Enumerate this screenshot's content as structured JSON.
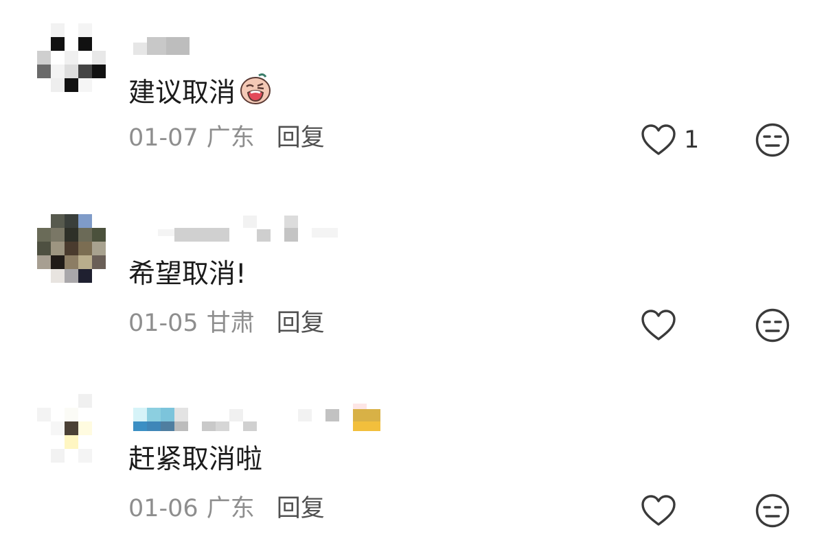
{
  "comments": [
    {
      "text": "建议取消",
      "date": "01-07",
      "region": "广东",
      "reply_label": "回复",
      "like_count": "1",
      "sticker": "crying-emoji-icon"
    },
    {
      "text": "希望取消!",
      "date": "01-05",
      "region": "甘肃",
      "reply_label": "回复",
      "like_count": ""
    },
    {
      "text": "赶紧取消啦",
      "date": "01-06",
      "region": "广东",
      "reply_label": "回复",
      "like_count": ""
    }
  ],
  "icons": {
    "like": "heart-icon",
    "dislike": "meh-face-icon"
  },
  "colors": {
    "text": "#1b1b1b",
    "meta": "#8e8e8e",
    "reply": "#505050",
    "icon": "#3a3a3a"
  }
}
